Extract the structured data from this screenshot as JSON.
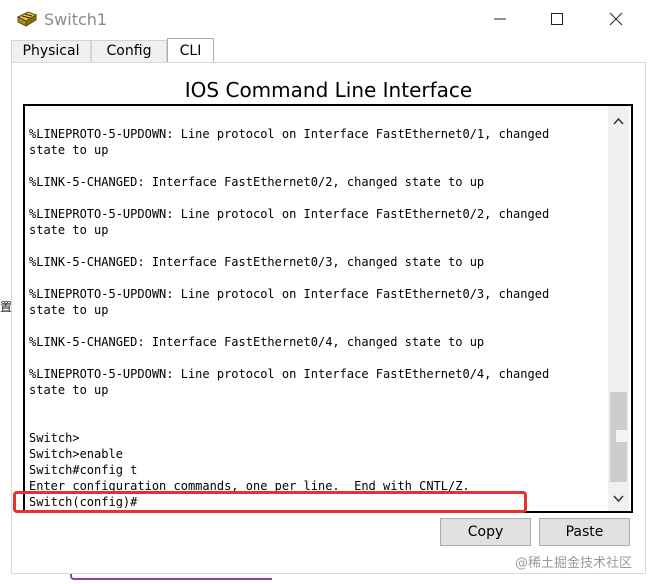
{
  "window": {
    "title": "Switch1",
    "icon": "switch-device-icon"
  },
  "tabs": [
    {
      "label": "Physical",
      "active": false
    },
    {
      "label": "Config",
      "active": false
    },
    {
      "label": "CLI",
      "active": true
    }
  ],
  "panel": {
    "title": "IOS Command Line Interface"
  },
  "terminal": {
    "lines": [
      "",
      "%LINEPROTO-5-UPDOWN: Line protocol on Interface FastEthernet0/1, changed",
      "state to up",
      "",
      "%LINK-5-CHANGED: Interface FastEthernet0/2, changed state to up",
      "",
      "%LINEPROTO-5-UPDOWN: Line protocol on Interface FastEthernet0/2, changed",
      "state to up",
      "",
      "%LINK-5-CHANGED: Interface FastEthernet0/3, changed state to up",
      "",
      "%LINEPROTO-5-UPDOWN: Line protocol on Interface FastEthernet0/3, changed",
      "state to up",
      "",
      "%LINK-5-CHANGED: Interface FastEthernet0/4, changed state to up",
      "",
      "%LINEPROTO-5-UPDOWN: Line protocol on Interface FastEthernet0/4, changed",
      "state to up",
      "",
      "",
      "Switch>",
      "Switch>enable",
      "Switch#config t",
      "Enter configuration commands, one per line.  End with CNTL/Z.",
      "Switch(config)#"
    ]
  },
  "buttons": {
    "copy": "Copy",
    "paste": "Paste"
  },
  "annotation": {
    "highlight_color": "#e5322d"
  },
  "left_edge_glyph": "置",
  "watermark": "@稀土掘金技术社区"
}
